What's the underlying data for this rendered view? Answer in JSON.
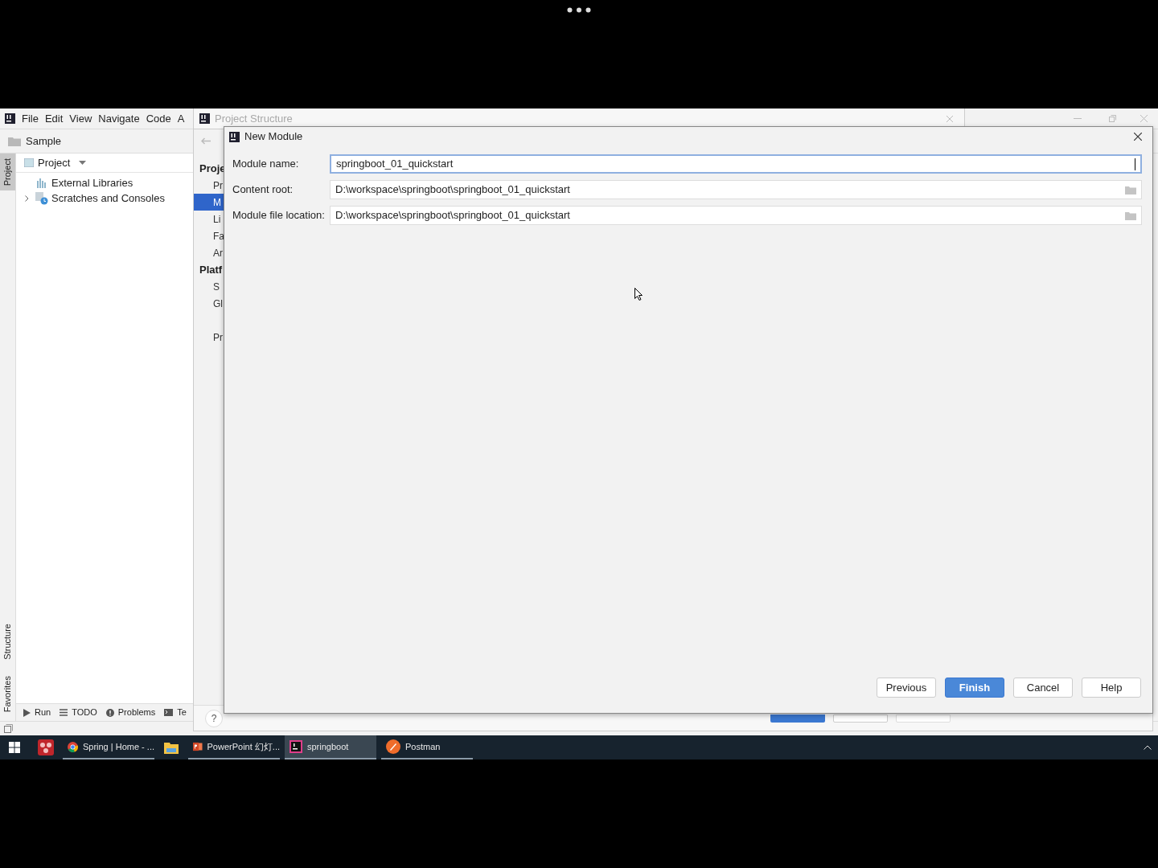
{
  "ide": {
    "menu": [
      "File",
      "Edit",
      "View",
      "Navigate",
      "Code",
      "A"
    ],
    "breadcrumb": "Sample",
    "project_view": {
      "title": "Project"
    },
    "tree": [
      {
        "label": "External Libraries",
        "kind": "libraries",
        "expandable": false
      },
      {
        "label": "Scratches and Consoles",
        "kind": "scratches",
        "expandable": true
      }
    ],
    "side_tabs_top": [
      {
        "label": "Project",
        "selected": true
      }
    ],
    "side_tabs_bottom": [
      {
        "label": "Structure",
        "selected": false
      },
      {
        "label": "Favorites",
        "selected": false
      }
    ],
    "bottom_tabs": [
      {
        "label": "Run",
        "kind": "run"
      },
      {
        "label": "TODO",
        "kind": "todo"
      },
      {
        "label": "Problems",
        "kind": "problems"
      },
      {
        "label": "Te",
        "kind": "terminal"
      }
    ]
  },
  "project_structure": {
    "title": "Project Structure",
    "help_label": "?",
    "sidebar": [
      {
        "label": "Proje",
        "kind": "heading"
      },
      {
        "label": "Pr",
        "kind": "item",
        "selected": false
      },
      {
        "label": "M",
        "kind": "item",
        "selected": true
      },
      {
        "label": "Li",
        "kind": "item",
        "selected": false
      },
      {
        "label": "Fa",
        "kind": "item",
        "selected": false
      },
      {
        "label": "Ar",
        "kind": "item",
        "selected": false
      },
      {
        "label": "Platf",
        "kind": "heading"
      },
      {
        "label": "S",
        "kind": "item",
        "selected": false
      },
      {
        "label": "Gl",
        "kind": "item",
        "selected": false
      },
      {
        "kind": "gap"
      },
      {
        "label": "Pr",
        "kind": "item",
        "selected": false
      }
    ]
  },
  "new_module": {
    "title": "New Module",
    "fields": [
      {
        "label": "Module name:",
        "value": "springboot_01_quickstart",
        "focused": true,
        "browse": false
      },
      {
        "label": "Content root:",
        "value": "D:\\workspace\\springboot\\springboot_01_quickstart",
        "focused": false,
        "browse": true
      },
      {
        "label": "Module file location:",
        "value": "D:\\workspace\\springboot\\springboot_01_quickstart",
        "focused": false,
        "browse": true
      }
    ],
    "buttons": [
      {
        "label": "Previous",
        "primary": false
      },
      {
        "label": "Finish",
        "primary": true
      },
      {
        "label": "Cancel",
        "primary": false
      },
      {
        "label": "Help",
        "primary": false
      }
    ]
  },
  "taskbar": {
    "items": [
      {
        "kind": "app",
        "active": false
      },
      {
        "kind": "chrome",
        "label": "Spring | Home - ...",
        "active": false
      },
      {
        "kind": "explorer",
        "active": false
      },
      {
        "kind": "powerpoint",
        "label": "PowerPoint 幻灯...",
        "active": false
      },
      {
        "kind": "intellij",
        "label": "springboot",
        "active": true
      },
      {
        "kind": "postman",
        "label": "Postman",
        "active": false
      }
    ]
  }
}
